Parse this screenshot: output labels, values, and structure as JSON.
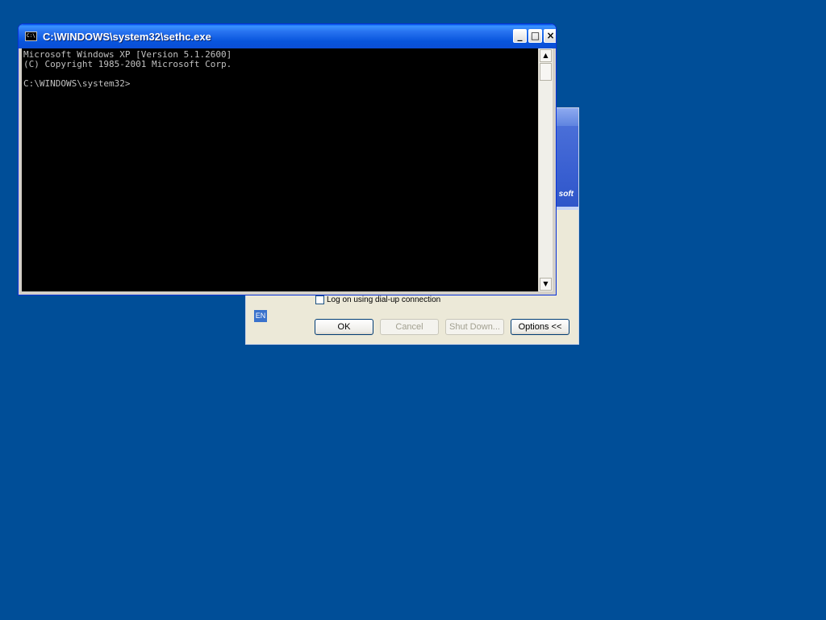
{
  "desktop": {
    "background_color": "#004e98"
  },
  "console": {
    "title": "C:\\WINDOWS\\system32\\sethc.exe",
    "icon": "cmd-icon",
    "icon_text": "C:\\",
    "lines": [
      "Microsoft Windows XP [Version 5.1.2600]",
      "(C) Copyright 1985-2001 Microsoft Corp.",
      "",
      "C:\\WINDOWS\\system32>"
    ],
    "controls": {
      "minimize": "_",
      "maximize": "□",
      "close": "×"
    },
    "scrollbar": {
      "up": "▲",
      "down": "▼"
    }
  },
  "logon": {
    "banner_text": "soft",
    "dialup_label": "Log on using dial-up connection",
    "language": "EN",
    "buttons": {
      "ok": "OK",
      "cancel": "Cancel",
      "shutdown": "Shut Down...",
      "options": "Options <<"
    }
  }
}
